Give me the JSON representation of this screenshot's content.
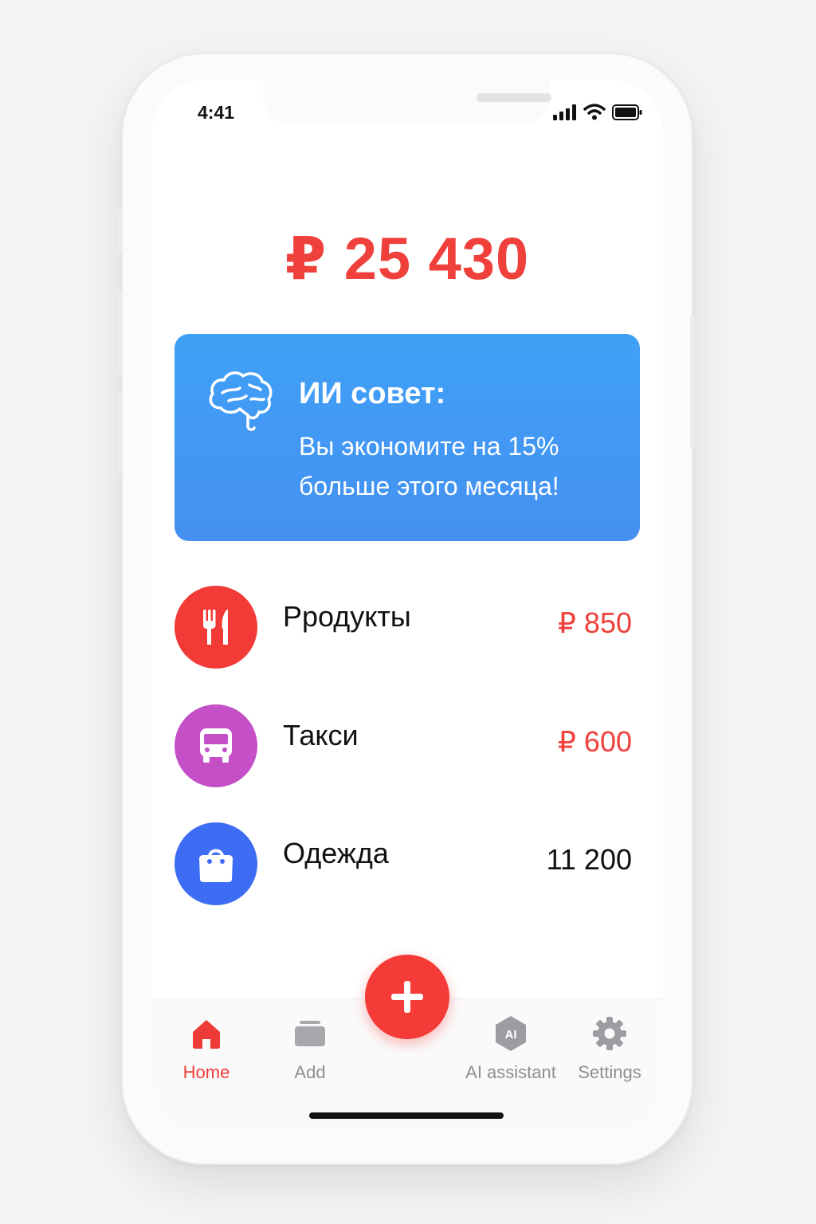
{
  "status_bar": {
    "time": "4:41",
    "icons": [
      "signal-icon",
      "wifi-icon",
      "battery-icon"
    ]
  },
  "balance": {
    "amount": "₽ 25 430",
    "color": "#f0403b"
  },
  "ai_tip": {
    "icon": "brain-icon",
    "title": "ИИ совет:",
    "message": "Вы экономите на 15% больше этого месяца!",
    "background": "#4098f4"
  },
  "categories": [
    {
      "name": "Рродукты",
      "amount": "₽ 850",
      "icon": "fork-knife-icon",
      "color": "#f23b36",
      "amount_color": "#f0403b"
    },
    {
      "name": "Такси",
      "amount": "₽ 600",
      "icon": "bus-icon",
      "color": "#c44fc7",
      "amount_color": "#f0403b"
    },
    {
      "name": "Одежда",
      "amount": "11 200",
      "icon": "shopping-bag-icon",
      "color": "#3d6cf5",
      "amount_color": "#111111"
    }
  ],
  "fab": {
    "icon": "plus-icon",
    "color": "#f43b37"
  },
  "tabbar": {
    "active_color": "#ef3b37",
    "inactive_color": "#8e8e93",
    "items": [
      {
        "label": "Home",
        "icon": "home-icon",
        "active": true
      },
      {
        "label": "Add",
        "icon": "cards-icon",
        "active": false
      },
      {
        "label": "AI assistant",
        "icon": "ai-hexagon-icon",
        "active": false
      },
      {
        "label": "Settings",
        "icon": "gear-icon",
        "active": false
      }
    ]
  }
}
